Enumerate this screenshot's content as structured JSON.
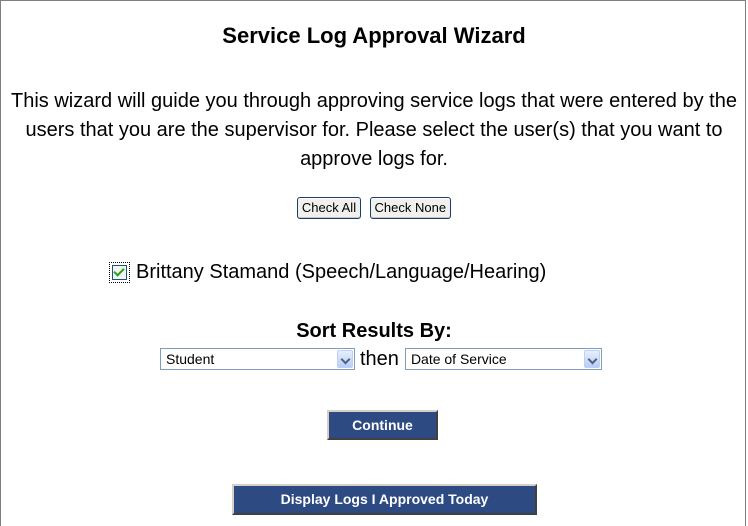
{
  "title": "Service Log Approval Wizard",
  "intro": "This wizard will guide you through approving service logs that were entered by the users that you are the supervisor for. Please select the user(s) that you want to approve logs for.",
  "buttons": {
    "check_all": "Check All",
    "check_none": "Check None",
    "continue": "Continue",
    "display_logs": "Display Logs I Approved Today"
  },
  "users": [
    {
      "name": "Brittany Stamand (Speech/Language/Hearing)",
      "checked": true
    }
  ],
  "sort": {
    "label": "Sort Results By:",
    "first": "Student",
    "joiner": "then",
    "second": "Date of Service"
  }
}
